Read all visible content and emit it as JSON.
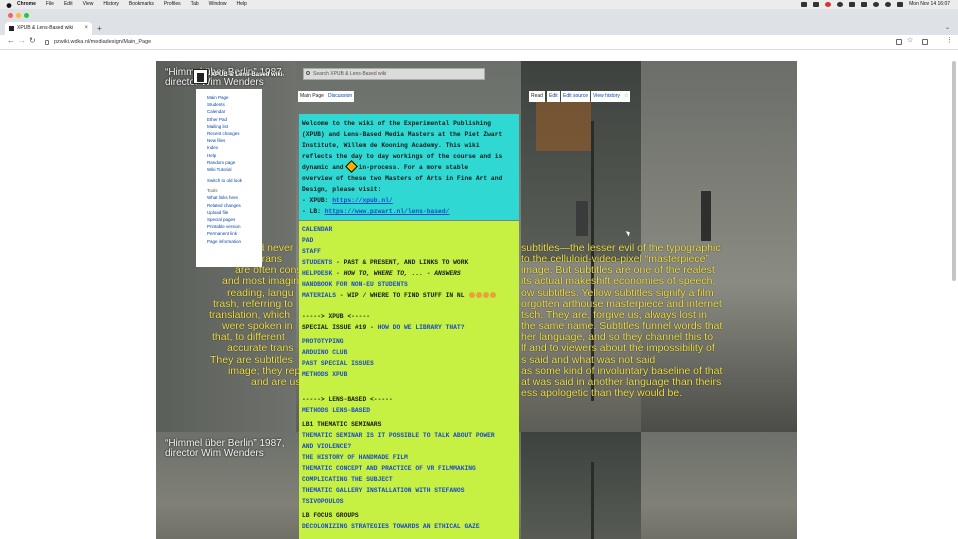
{
  "menubar": {
    "app": "Chrome",
    "items": [
      "File",
      "Edit",
      "View",
      "History",
      "Bookmarks",
      "Profiles",
      "Tab",
      "Window",
      "Help"
    ],
    "clock": "Mon Nov 14  16:07"
  },
  "browser": {
    "tab_title": "XPUB & Lens-Based wiki",
    "url": "pzwiki.wdka.nl/mediadesign/Main_Page"
  },
  "wiki": {
    "site_name": "XPUB & Lens-Based wiki",
    "search_placeholder": "Search XPUB & Lens-Based wiki",
    "tabs_left": [
      "Main Page",
      "Discussion"
    ],
    "tabs_right": [
      "Read",
      "Edit",
      "Edit source",
      "View history"
    ],
    "sidebar": {
      "nav": [
        "Main Page",
        "Students",
        "Calendar",
        "Ether Pad",
        "Mailing list",
        "Recent changes",
        "New files",
        "Index",
        "Help",
        "Random page",
        "Wiki Tutorial"
      ],
      "switch": "Switch to old look",
      "tools_heading": "Tools",
      "tools": [
        "What links here",
        "Related changes",
        "Upload file",
        "Special pages",
        "Printable version",
        "Permanent link",
        "Page information"
      ]
    },
    "intro": {
      "lines": [
        "Welcome to the wiki of the Experimental Publishing",
        "(XPUB) and Lens-Based Media Masters at the Piet Zwart",
        "Institute, Willem de Kooning Academy. This wiki",
        "reflects the day to day workings of the course and is"
      ],
      "line5_a": "dynamic and",
      "line5_b": "in-process. For a more stable",
      "line6": "overview of these two Masters of Arts in Fine Art and",
      "line7": "Design, please visit:",
      "xpub_label": "- XPUB:",
      "xpub_url": "https://xpub.nl/",
      "lb_label": "- LB:",
      "lb_url": "https://www.pzwart.nl/lens-based/"
    },
    "links": {
      "calendar": "CALENDAR",
      "pad": "PAD",
      "staff": "STAFF",
      "students": "STUDENTS",
      "students_desc": " - PAST & PRESENT, AND LINKS TO WORK",
      "helpdesk": "HELPDESK",
      "helpdesk_desc": " - HOW TO, WHERE TO, ... - ANSWERS",
      "handbook": "HANDBOOK FOR NON-EU STUDENTS",
      "materials": "MATERIALS",
      "materials_desc": " - WIP / WHERE TO FIND STUFF IN NL",
      "xpub_head": "-----> XPUB <-----",
      "special_issue": "SPECIAL ISSUE #19 - ",
      "special_issue_link": "HOW DO WE LIBRARY THAT?",
      "prototyping": "PROTOTYPING",
      "arduino": "ARDUINO CLUB",
      "past_special": "PAST SPECIAL ISSUES",
      "methods_xpub": "METHODS XPUB",
      "lb_head": "-----> LENS-BASED <-----",
      "methods_lb": "METHODS LENS-BASED",
      "lb1": "LB1 THEMATIC SEMINARS",
      "t1a": "THEMATIC SEMINAR IS IT POSSIBLE TO TALK ABOUT POWER",
      "t1b": "AND VIOLENCE?",
      "t2": "THE HISTORY OF HANDMADE FILM",
      "t3": "THEMATIC CONCEPT AND PRACTICE OF VR FILMMAKING",
      "t4": "COMPLICATING THE SUBJECT",
      "t5a": "THEMATIC GALLERY INSTALLATION WITH STEFANOS",
      "t5b": "TSIVOPOULOS",
      "lb_focus": "LB FOCUS GROUPS",
      "decol": "DECOLONIZING STRATEGIES TOWARDS AN ETHICAL GAZE"
    }
  },
  "video": {
    "title_lines": [
      "“Himmel über Berlin” 1987,",
      "director Wim Wenders"
    ],
    "subtitles_left": [
      "ld never",
      "of trans",
      "are often cons",
      "and most imagin",
      "reading, langu",
      "trash, referring to",
      "translation, which",
      "were spoken in",
      "that, to different",
      "accurate trans",
      "They are subtitles",
      "image; they repr",
      "and are us"
    ],
    "subtitles_right": [
      "subtitles—the lesser evil of the typographic",
      "to the celluloid-video-pixel “masterpiece”",
      "image. But subtitles are one of the realest",
      "its actual makeshift economies of speech,",
      "ow subtitles. Yellow subtitles signify a film",
      "orgotten arthouse masterpiece and internet",
      "tsch. They are, forgive us, always lost in",
      "the same name. Subtitles funnel words that",
      "her language, and so they channel this to",
      "lf and to viewers about the impossibility of",
      "s said and what was not said",
      "as some kind of involuntary baseline of that",
      "at was said in another language than theirs",
      "ess apologetic than they would be."
    ]
  }
}
